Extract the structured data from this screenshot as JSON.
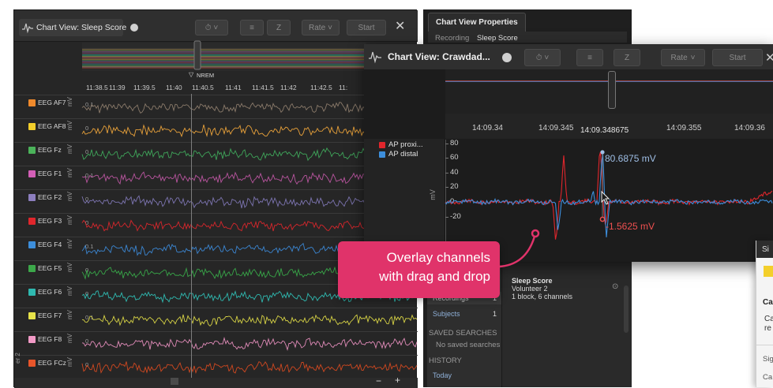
{
  "main_window": {
    "title": "Chart View: Sleep Score",
    "rate_label": "Rate",
    "start_label": "Start",
    "event_label": "NREM",
    "time_ticks": [
      "11:38.5",
      "11:39",
      "11:39.5",
      "11:40",
      "11:40.5",
      "11:41",
      "11:41.5",
      "11:42",
      "11:42.5",
      "11:"
    ],
    "unit": "mV",
    "scale_a": "0.1",
    "scale_b": "0.0",
    "scale_c": "0",
    "side_marker": "er 2",
    "channels": [
      {
        "name": "EEG AF7",
        "color": "#f08a2c",
        "trace": "#8a7a6a"
      },
      {
        "name": "EEG AF8",
        "color": "#f3cf2b",
        "trace": "#e8a13a"
      },
      {
        "name": "EEG Fz",
        "color": "#4bb35a",
        "trace": "#3fa55a"
      },
      {
        "name": "EEG F1",
        "color": "#d35fb7",
        "trace": "#b9559f"
      },
      {
        "name": "EEG F2",
        "color": "#8d7fbf",
        "trace": "#7c74b0"
      },
      {
        "name": "EEG F3",
        "color": "#e0262c",
        "trace": "#d6262c"
      },
      {
        "name": "EEG F4",
        "color": "#3d8edb",
        "trace": "#3b86d2"
      },
      {
        "name": "EEG F5",
        "color": "#3ca84a",
        "trace": "#38a548"
      },
      {
        "name": "EEG F6",
        "color": "#2fb9b0",
        "trace": "#2fb9b0"
      },
      {
        "name": "EEG F7",
        "color": "#e7e34a",
        "trace": "#d6d245"
      },
      {
        "name": "EEG F8",
        "color": "#f29ac6",
        "trace": "#e08bb8"
      },
      {
        "name": "EEG FCz",
        "color": "#e8552a",
        "trace": "#d04820"
      }
    ]
  },
  "properties_panel": {
    "title": "Chart View Properties",
    "recording_label": "Recording",
    "recording_value": "Sleep Score"
  },
  "browser_panel": {
    "recordings_label": "Recordings",
    "recordings_count": "1",
    "subjects_label": "Subjects",
    "subjects_count": "1",
    "saved_header": "SAVED SEARCHES",
    "saved_empty": "No saved searches",
    "history_header": "HISTORY",
    "history_today": "Today",
    "item_title": "Sleep Score",
    "item_subject": "Volunteer 2",
    "item_detail": "1 block, 6 channels"
  },
  "overlay_window": {
    "title": "Chart View: Crawdad...",
    "rate_label": "Rate",
    "start_label": "Start",
    "time_ticks": [
      "14:09.34",
      "14:09.345",
      "14:09.35",
      "14:09.355",
      "14:09.36"
    ],
    "cursor_time": "14:09.348675",
    "unit": "mV",
    "y_ticks": [
      "80",
      "60",
      "40",
      "20",
      "0",
      "-20"
    ],
    "channels": [
      {
        "name": "AP proxi...",
        "color": "#e0262c"
      },
      {
        "name": "AP distal",
        "color": "#3d8edb"
      }
    ],
    "readout_high": "80.6875 mV",
    "readout_low": "-1.5625 mV"
  },
  "side_panel": {
    "title_fragment": "Si",
    "section_fragment": "Ca",
    "line_fragment_1": "Ca",
    "line_fragment_2": "re",
    "row_fragment_1": "Sig",
    "row_fragment_2": "Ca"
  },
  "callout": {
    "line1": "Overlay channels",
    "line2": "with drag and drop",
    "color": "#e0336a"
  }
}
